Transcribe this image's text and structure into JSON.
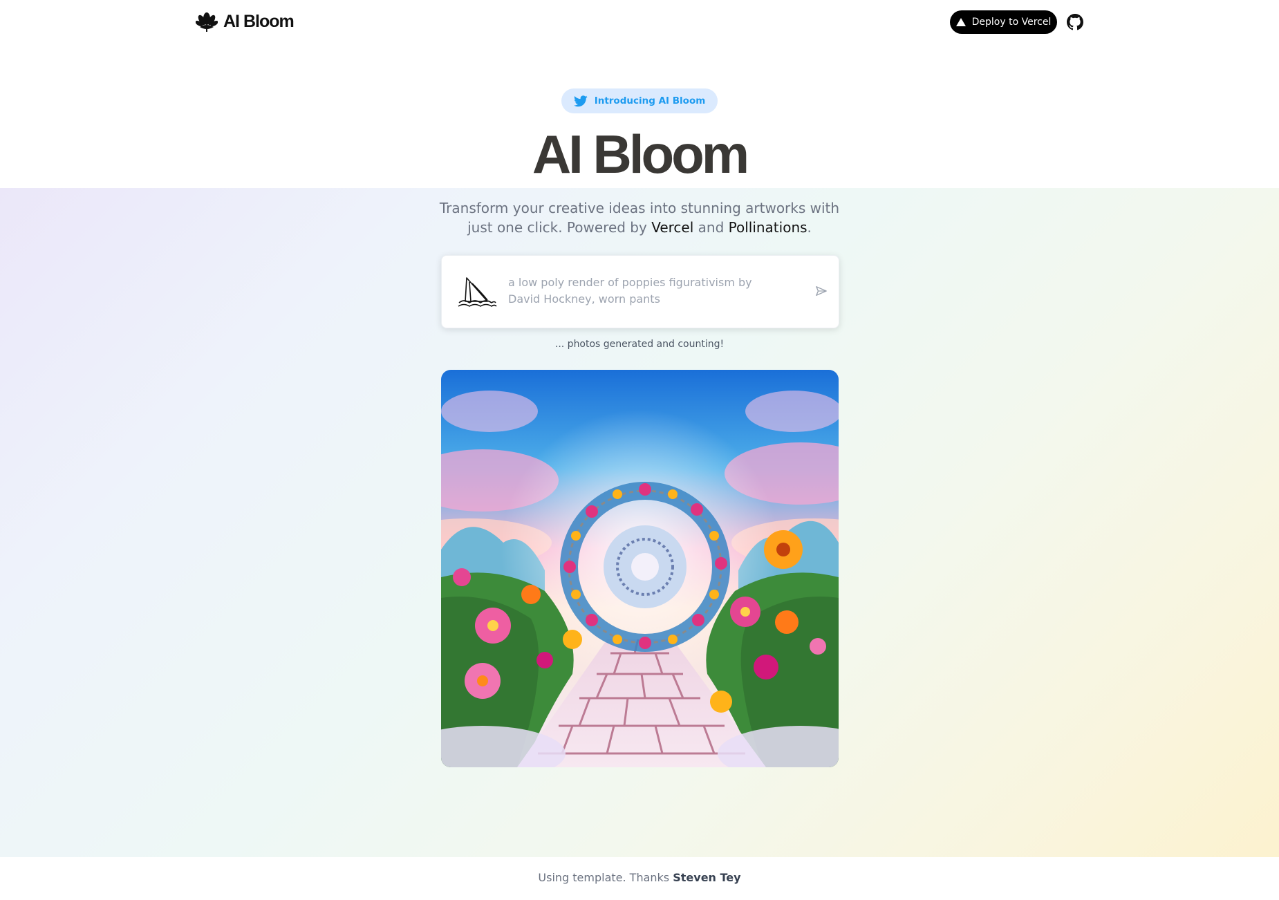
{
  "header": {
    "logo_text": "AI Bloom",
    "deploy_label": "Deploy to Vercel"
  },
  "hero": {
    "badge_label": "Introducing AI Bloom",
    "title": "AI Bloom",
    "subtitle_part1": "Transform your creative ideas into stunning artworks with just one click. Powered by ",
    "subtitle_link1": "Vercel",
    "subtitle_and": " and ",
    "subtitle_link2": "Pollinations",
    "subtitle_end": "."
  },
  "prompt": {
    "placeholder": "a low poly render of poppies figurativism by David Hockney, worn pants"
  },
  "counter_text": "... photos generated and counting!",
  "footer": {
    "prefix": "Using template. Thanks ",
    "author": "Steven Tey"
  },
  "colors": {
    "badge_bg": "#dbeafe",
    "badge_text": "#1d9bf0",
    "button_bg": "#000000"
  },
  "icons": [
    "logo-flower-icon",
    "vercel-triangle-icon",
    "github-icon",
    "twitter-icon",
    "midjourney-boat-icon",
    "send-icon"
  ]
}
